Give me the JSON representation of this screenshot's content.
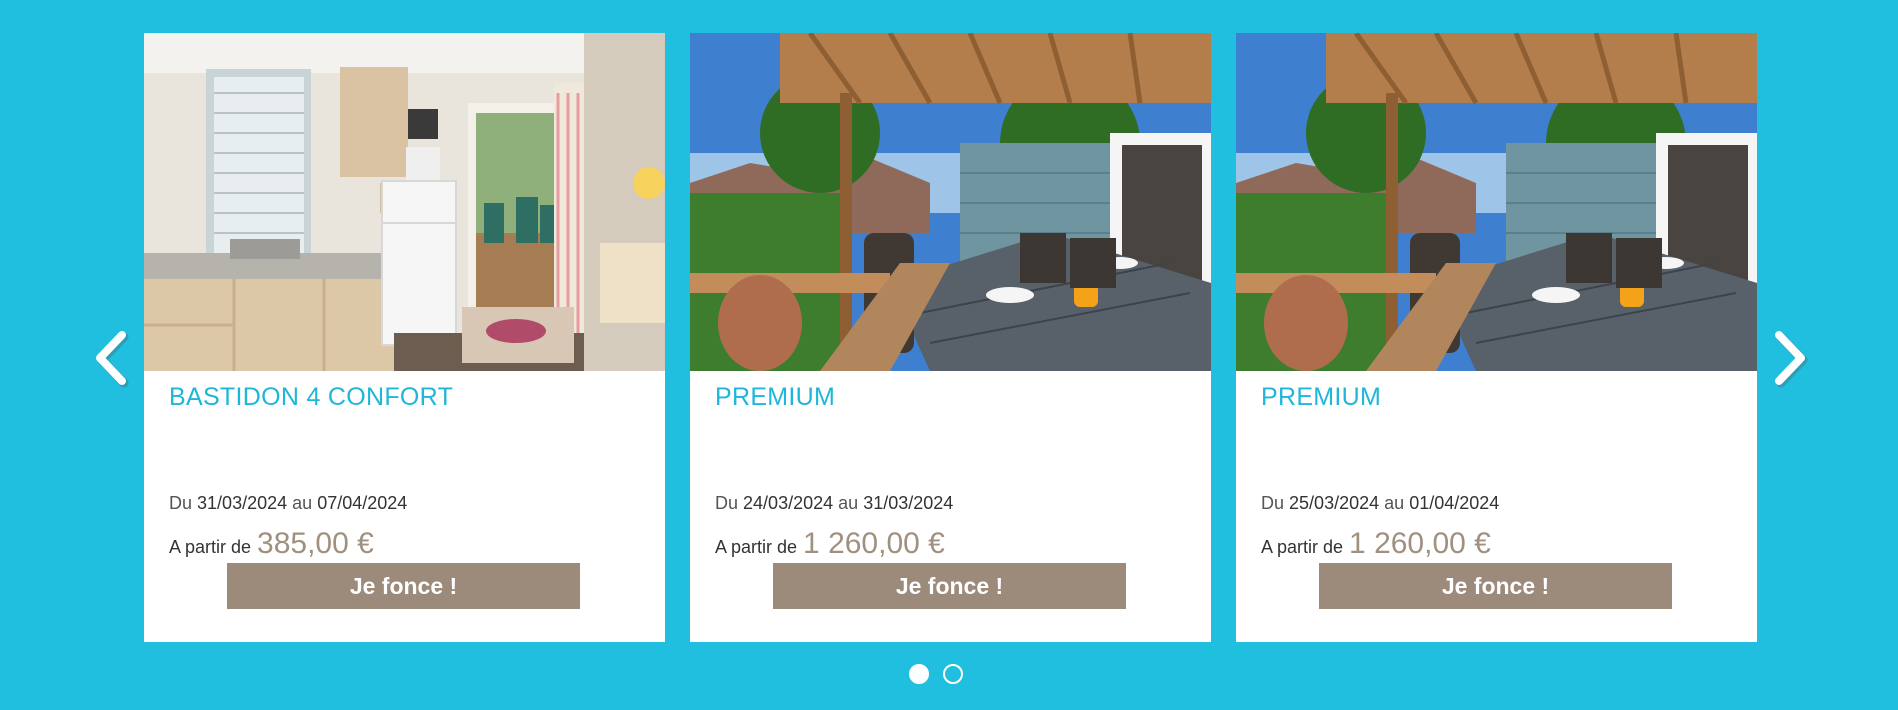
{
  "colors": {
    "background": "#20bfdf",
    "title": "#1fb7d8",
    "price": "#a09080",
    "button": "#9c8b7b"
  },
  "carousel": {
    "prev_icon": "chevron-left-icon",
    "next_icon": "chevron-right-icon",
    "cards": [
      {
        "image": "mobile-home-kitchen-photo",
        "title": "BASTIDON 4 CONFORT",
        "du": "Du",
        "start": "31/03/2024",
        "au": "au",
        "end": "07/04/2024",
        "price_prefix": "A partir de",
        "price": "385,00 €",
        "button": "Je fonce !"
      },
      {
        "image": "terrace-dining-photo",
        "title": "PREMIUM",
        "du": "Du",
        "start": "24/03/2024",
        "au": "au",
        "end": "31/03/2024",
        "price_prefix": "A partir de",
        "price": "1 260,00 €",
        "button": "Je fonce !"
      },
      {
        "image": "terrace-dining-photo",
        "title": "PREMIUM",
        "du": "Du",
        "start": "25/03/2024",
        "au": "au",
        "end": "01/04/2024",
        "price_prefix": "A partir de",
        "price": "1 260,00 €",
        "button": "Je fonce !"
      }
    ],
    "pagination": {
      "pages": 2,
      "active": 1
    }
  }
}
